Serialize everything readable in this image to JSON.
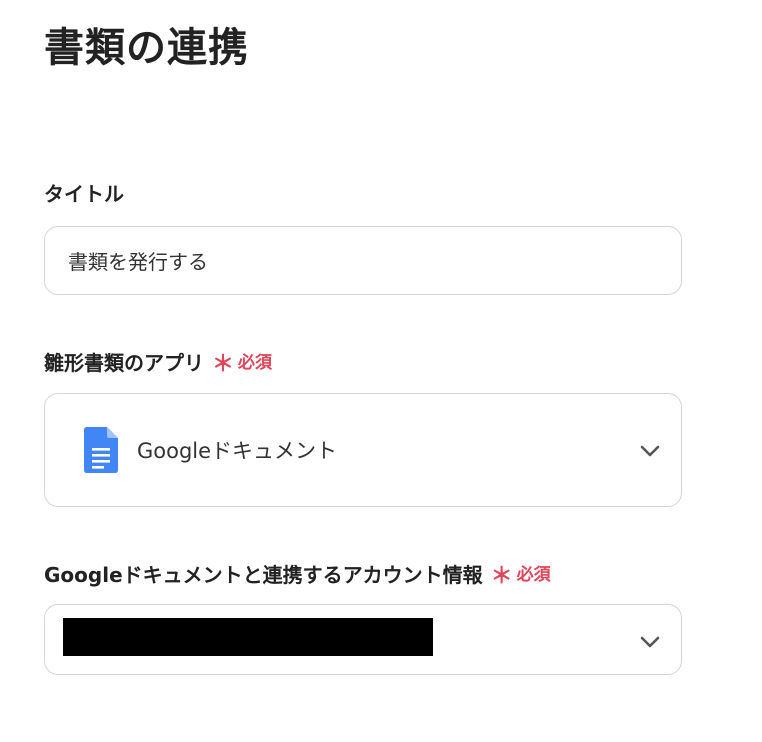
{
  "page": {
    "title": "書類の連携"
  },
  "title_field": {
    "label": "タイトル",
    "value": "書類を発行する"
  },
  "template_app_field": {
    "label": "雛形書類のアプリ",
    "required_mark": "＊",
    "required_text": "必須",
    "selected_app": "Googleドキュメント",
    "app_icon": "google-docs-icon"
  },
  "account_field": {
    "label": "Googleドキュメントと連携するアカウント情報",
    "required_mark": "＊",
    "required_text": "必須",
    "value_redacted": true
  },
  "colors": {
    "required": "#e0455a",
    "border": "#d4d4d8",
    "google_docs_blue": "#4285f4",
    "text": "#222222"
  }
}
